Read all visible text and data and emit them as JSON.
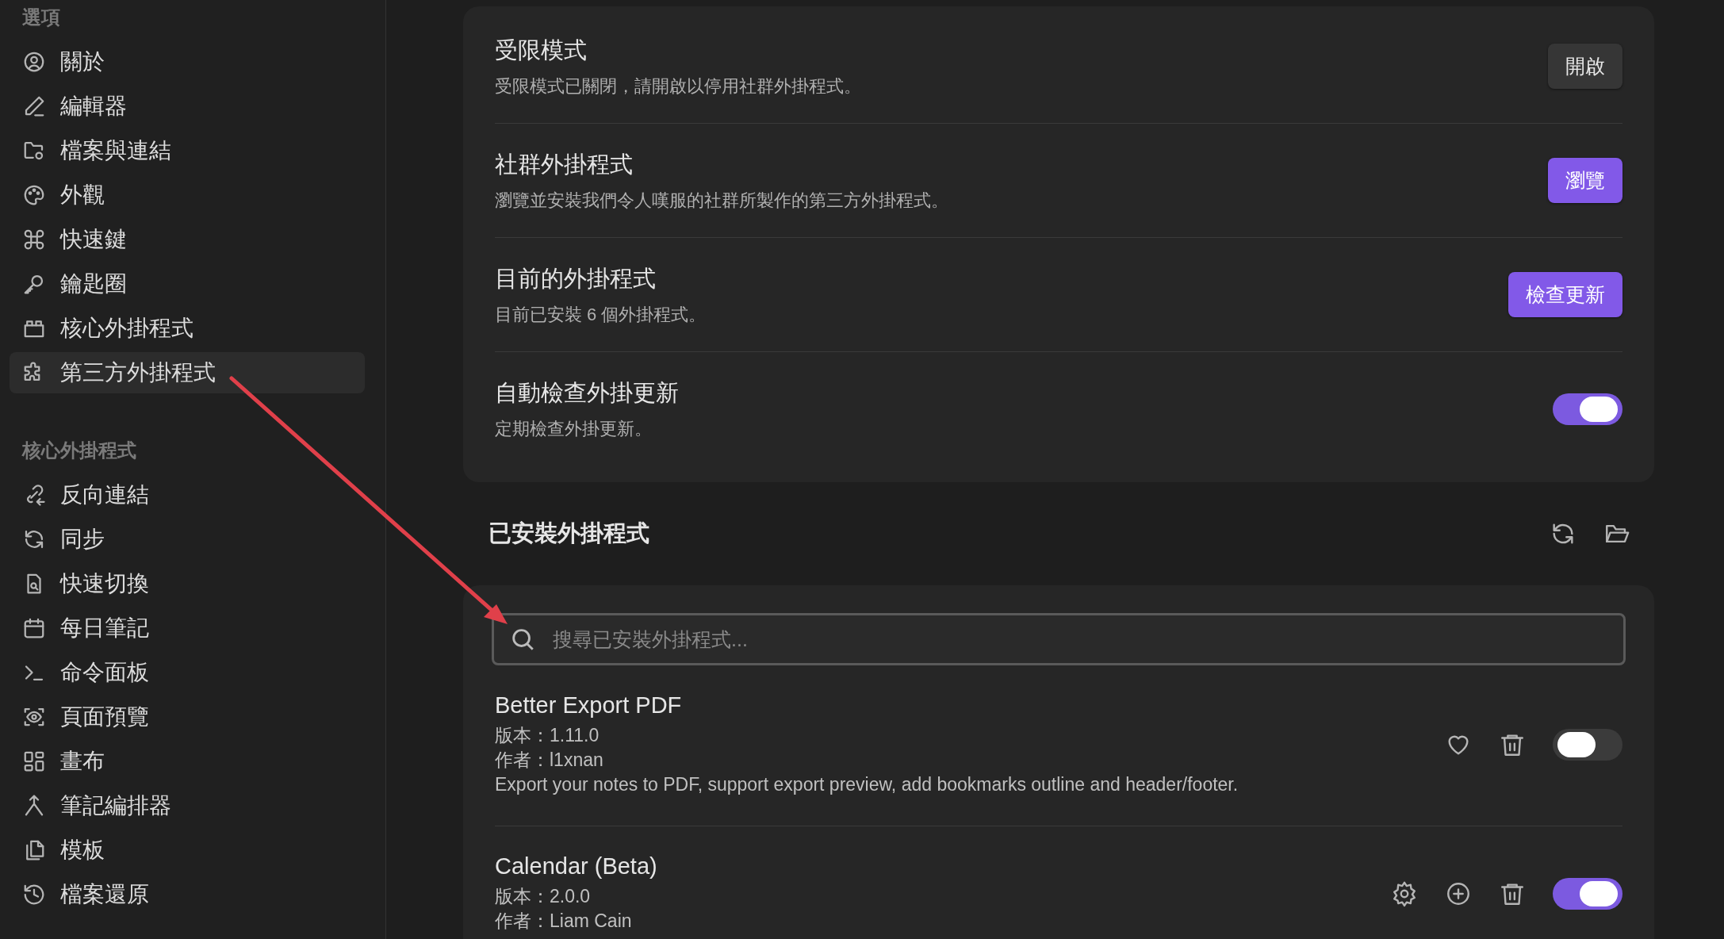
{
  "sidebar": {
    "sections": [
      {
        "heading": "選項",
        "items": [
          {
            "label": "關於",
            "selected": false
          },
          {
            "label": "編輯器",
            "selected": false
          },
          {
            "label": "檔案與連結",
            "selected": false
          },
          {
            "label": "外觀",
            "selected": false
          },
          {
            "label": "快速鍵",
            "selected": false
          },
          {
            "label": "鑰匙圈",
            "selected": false
          },
          {
            "label": "核心外掛程式",
            "selected": false
          },
          {
            "label": "第三方外掛程式",
            "selected": true
          }
        ]
      },
      {
        "heading": "核心外掛程式",
        "items": [
          {
            "label": "反向連結",
            "selected": false
          },
          {
            "label": "同步",
            "selected": false
          },
          {
            "label": "快速切換",
            "selected": false
          },
          {
            "label": "每日筆記",
            "selected": false
          },
          {
            "label": "命令面板",
            "selected": false
          },
          {
            "label": "頁面預覽",
            "selected": false
          },
          {
            "label": "畫布",
            "selected": false
          },
          {
            "label": "筆記編排器",
            "selected": false
          },
          {
            "label": "模板",
            "selected": false
          },
          {
            "label": "檔案還原",
            "selected": false
          }
        ]
      }
    ]
  },
  "settings": [
    {
      "title": "受限模式",
      "description": "受限模式已關閉，請開啟以停用社群外掛程式。",
      "kind": "button",
      "button": "開啟",
      "accent": false
    },
    {
      "title": "社群外掛程式",
      "description": "瀏覽並安裝我們令人嘆服的社群所製作的第三方外掛程式。",
      "kind": "button",
      "button": "瀏覽",
      "accent": true
    },
    {
      "title": "目前的外掛程式",
      "description": "目前已安裝 6 個外掛程式。",
      "kind": "button",
      "button": "檢查更新",
      "accent": true
    },
    {
      "title": "自動檢查外掛更新",
      "description": "定期檢查外掛更新。",
      "kind": "toggle",
      "on": true
    }
  ],
  "installed": {
    "title": "已安裝外掛程式",
    "search": {
      "placeholder": "搜尋已安裝外掛程式..."
    },
    "plugins": [
      {
        "name": "Better Export PDF",
        "version": "版本：1.11.0",
        "author": "作者：l1xnan",
        "description": "Export your notes to PDF, support export preview, add bookmarks outline and header/footer.",
        "actions": [
          {
            "kind": "heart"
          },
          {
            "kind": "trash"
          }
        ],
        "on": false
      },
      {
        "name": "Calendar (Beta)",
        "version": "版本：2.0.0",
        "author": "作者：Liam Cain",
        "actions": [
          {
            "kind": "gear"
          },
          {
            "kind": "plus"
          },
          {
            "kind": "trash"
          }
        ],
        "on": true
      }
    ]
  }
}
